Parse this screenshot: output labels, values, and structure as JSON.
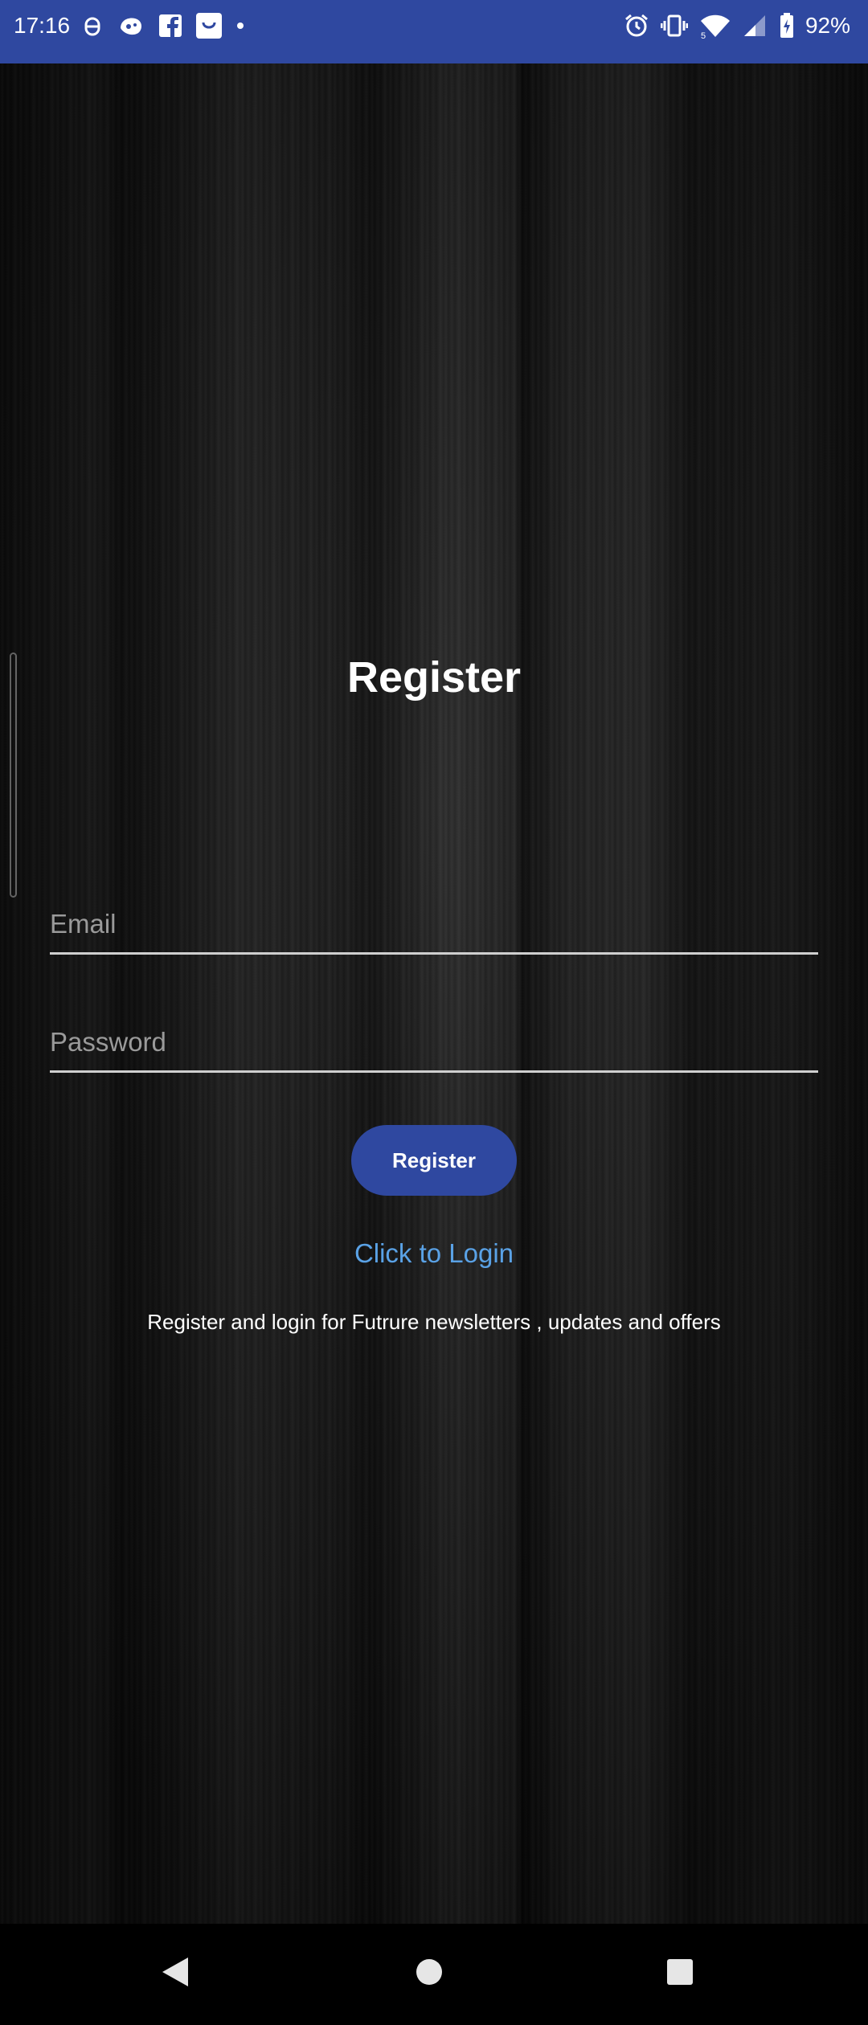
{
  "status_bar": {
    "time": "17:16",
    "battery": "92%",
    "left_icons": [
      "bug-icon",
      "gamepad-icon",
      "facebook-icon",
      "shopping-bag-icon",
      "dot-icon"
    ],
    "right_icons": [
      "alarm-icon",
      "vibrate-icon",
      "wifi-icon",
      "signal-icon",
      "battery-icon"
    ],
    "color": "#2f48a0"
  },
  "form": {
    "title": "Register",
    "email_placeholder": "Email",
    "password_placeholder": "Password",
    "submit_label": "Register",
    "login_link": "Click to Login",
    "info": "Register and login for Futrure newsletters , updates and offers"
  },
  "colors": {
    "accent": "#2f48a0",
    "link": "#5aa2e6"
  },
  "nav_bar": {
    "icons": [
      "back-icon",
      "home-icon",
      "recents-icon"
    ]
  }
}
